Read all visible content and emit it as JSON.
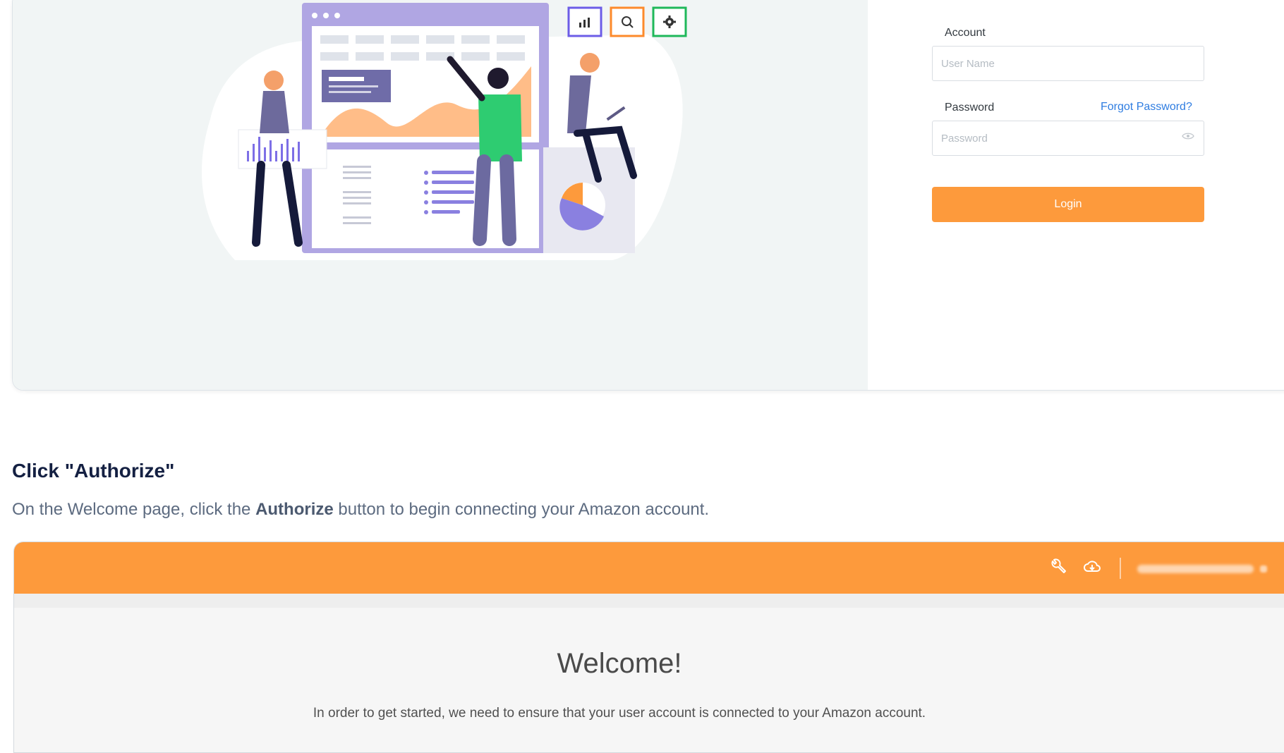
{
  "login": {
    "account_label": "Account",
    "username_placeholder": "User Name",
    "password_label": "Password",
    "forgot_password": "Forgot Password?",
    "password_placeholder": "Password",
    "login_button": "Login"
  },
  "step": {
    "title": "Click \"Authorize\"",
    "desc_before": "On the Welcome page, click the ",
    "desc_bold": "Authorize",
    "desc_after": " button to begin connecting your Amazon account."
  },
  "welcome": {
    "title": "Welcome!",
    "text": "In order to get started, we need to ensure that your user account is connected to your Amazon account."
  },
  "icons": {
    "topbar": [
      "wrench-icon",
      "cloud-download-icon"
    ],
    "illustration_badges": [
      "chart-icon",
      "search-icon",
      "gear-icon"
    ],
    "password_toggle": "eye-icon"
  },
  "colors": {
    "accent_orange": "#fd9a3c",
    "link_blue": "#2f7de1",
    "title_navy": "#142042",
    "badge_purple": "#6c5ce7",
    "badge_orange": "#fd8a2b",
    "badge_green": "#1fb85a"
  }
}
